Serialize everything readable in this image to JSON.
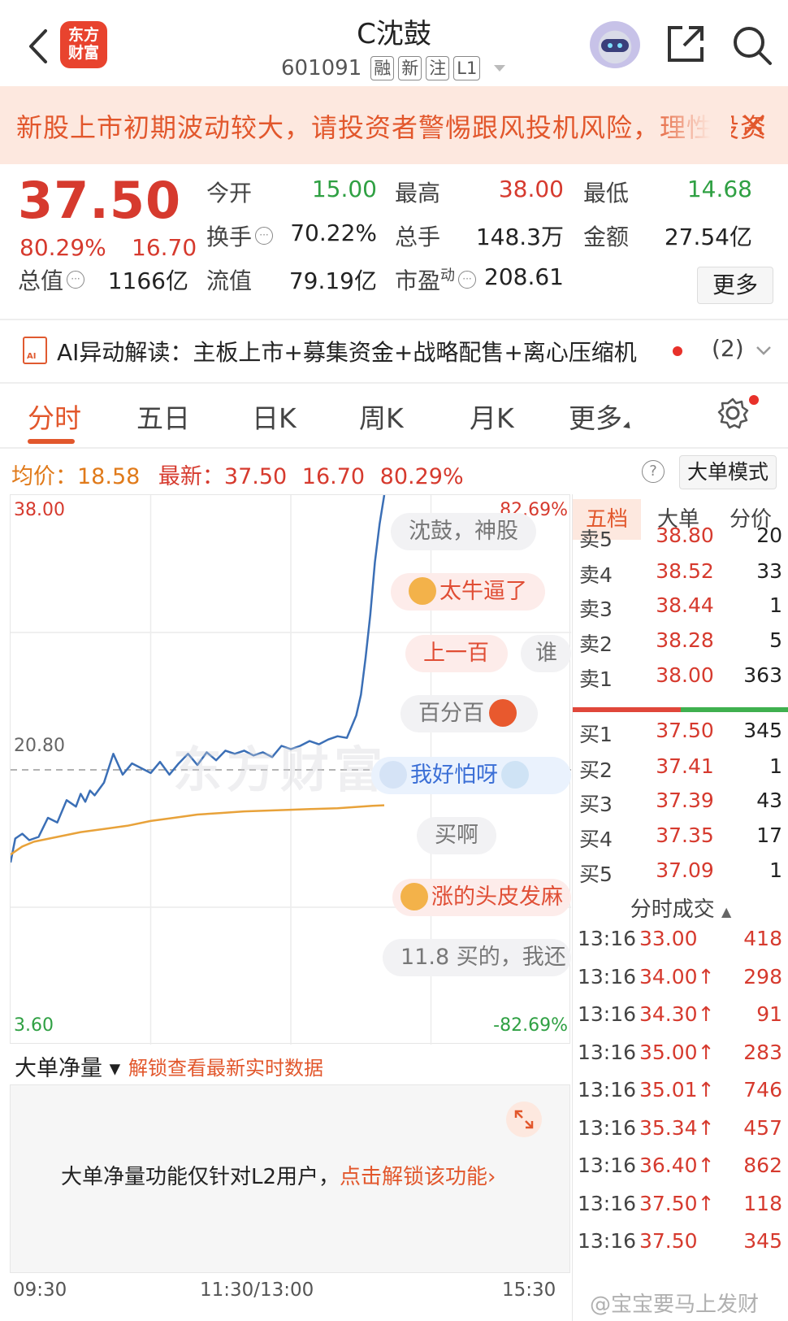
{
  "header": {
    "back_icon": "chevron-left-icon",
    "logo_line1": "东方",
    "logo_line2": "财富",
    "stock_name": "C沈鼓",
    "stock_code": "601091",
    "tags": [
      "融",
      "新",
      "注",
      "L1"
    ]
  },
  "banner": {
    "text": "新股上市初期波动较大，请投资者警惕跟风投机风险，理性投资"
  },
  "quote": {
    "price": "37.50",
    "change_pct": "80.29%",
    "change": "16.70",
    "fields": [
      {
        "label": "今开",
        "value": "15.00",
        "color": "#2fa043"
      },
      {
        "label": "最高",
        "value": "38.00",
        "color": "#d63a2e"
      },
      {
        "label": "最低",
        "value": "14.68",
        "color": "#2fa043"
      },
      {
        "label": "换手",
        "value": "70.22%",
        "color": "#222222"
      },
      {
        "label": "总手",
        "value": "148.3万",
        "color": "#222222"
      },
      {
        "label": "金额",
        "value": "27.54亿",
        "color": "#222222"
      },
      {
        "label": "总值",
        "value": "1166亿",
        "color": "#222222"
      },
      {
        "label": "流值",
        "value": "79.19亿",
        "color": "#222222"
      },
      {
        "label": "市盈",
        "value": "208.61",
        "color": "#222222"
      }
    ],
    "pe_sup": "动",
    "more_label": "更多"
  },
  "ai": {
    "text": "AI异动解读：主板上市+募集资金+战略配售+离心压缩机",
    "count": "(2)"
  },
  "tabs": [
    "分时",
    "五日",
    "日K",
    "周K",
    "月K",
    "更多"
  ],
  "avg_row": {
    "avg_label": "均价：",
    "avg_value": "18.58",
    "latest_label": "最新：",
    "latest_value": "37.50",
    "latest_change": "16.70",
    "latest_pct": "80.29%",
    "help": "?",
    "big_order_label": "大单模式"
  },
  "chart_axes": {
    "y_top": "38.00",
    "y_mid": "20.80",
    "y_bottom": "3.60",
    "pct_top": "82.69%",
    "pct_bottom": "-82.69%",
    "watermark": "东方财富"
  },
  "chart_data": {
    "type": "line",
    "xlabel": "",
    "ylabel": "",
    "x_ticks": [
      "09:30",
      "11:30/13:00",
      "15:30"
    ],
    "ylim": [
      3.6,
      38.0
    ],
    "reference": 20.8,
    "series": [
      {
        "color": "#3b6fb6",
        "x": [
          0,
          2,
          5,
          8,
          12,
          16,
          20,
          24,
          28,
          30,
          32,
          34,
          36,
          40,
          44,
          48,
          52,
          56,
          60,
          64,
          68,
          72,
          76,
          80,
          84,
          88,
          92,
          96,
          100,
          104,
          108,
          112,
          116,
          120,
          124,
          128,
          132,
          136,
          140,
          144,
          148,
          150,
          152,
          154,
          156,
          158,
          160
        ],
        "y": [
          15.0,
          16.5,
          16.8,
          16.4,
          16.6,
          17.8,
          17.5,
          18.9,
          18.5,
          19.3,
          18.8,
          19.5,
          19.2,
          20.0,
          21.8,
          20.5,
          21.2,
          20.9,
          20.6,
          21.3,
          20.5,
          21.2,
          21.8,
          21.1,
          21.9,
          21.4,
          22.0,
          21.8,
          22.0,
          21.7,
          21.9,
          21.6,
          22.3,
          22.1,
          22.3,
          22.6,
          22.4,
          22.7,
          22.9,
          22.8,
          24.2,
          25.5,
          27.8,
          30.5,
          33.8,
          36.2,
          38.0
        ]
      },
      {
        "color": "#e8a23a",
        "x": [
          0,
          5,
          10,
          20,
          30,
          40,
          50,
          60,
          70,
          80,
          90,
          100,
          110,
          120,
          130,
          140,
          150,
          155,
          160
        ],
        "y": [
          15.5,
          16.0,
          16.3,
          16.6,
          16.9,
          17.1,
          17.3,
          17.6,
          17.8,
          18.0,
          18.1,
          18.2,
          18.25,
          18.3,
          18.35,
          18.4,
          18.5,
          18.55,
          18.58
        ]
      }
    ]
  },
  "danmaku": [
    {
      "text": "沈鼓，神股",
      "style": "gray"
    },
    {
      "text": "太牛逼了",
      "style": "pink"
    },
    {
      "text": "上一百",
      "style": "pink"
    },
    {
      "text": "谁",
      "style": "gray"
    },
    {
      "text": "百分百",
      "style": "gray"
    },
    {
      "text": "我好怕呀",
      "style": "blue"
    },
    {
      "text": "买啊",
      "style": "gray"
    },
    {
      "text": "涨的头皮发麻",
      "style": "pink"
    },
    {
      "text": "11.8 买的，我还",
      "style": "gray"
    }
  ],
  "orderbook": {
    "tabs": [
      "五档",
      "大单",
      "分价"
    ],
    "sells": [
      {
        "label": "卖5",
        "price": "38.80",
        "vol": "20"
      },
      {
        "label": "卖4",
        "price": "38.52",
        "vol": "33"
      },
      {
        "label": "卖3",
        "price": "38.44",
        "vol": "1"
      },
      {
        "label": "卖2",
        "price": "38.28",
        "vol": "5"
      },
      {
        "label": "卖1",
        "price": "38.00",
        "vol": "363"
      }
    ],
    "buys": [
      {
        "label": "买1",
        "price": "37.50",
        "vol": "345"
      },
      {
        "label": "买2",
        "price": "37.41",
        "vol": "1"
      },
      {
        "label": "买3",
        "price": "37.39",
        "vol": "43"
      },
      {
        "label": "买4",
        "price": "37.35",
        "vol": "17"
      },
      {
        "label": "买5",
        "price": "37.09",
        "vol": "1"
      }
    ],
    "trades_title": "分时成交",
    "trades": [
      {
        "time": "13:16",
        "price": "33.00",
        "vol": "418"
      },
      {
        "time": "13:16",
        "price": "34.00↑",
        "vol": "298"
      },
      {
        "time": "13:16",
        "price": "34.30↑",
        "vol": "91"
      },
      {
        "time": "13:16",
        "price": "35.00↑",
        "vol": "283"
      },
      {
        "time": "13:16",
        "price": "35.01↑",
        "vol": "746"
      },
      {
        "time": "13:16",
        "price": "35.34↑",
        "vol": "457"
      },
      {
        "time": "13:16",
        "price": "36.40↑",
        "vol": "862"
      },
      {
        "time": "13:16",
        "price": "37.50↑",
        "vol": "118"
      },
      {
        "time": "13:16",
        "price": "37.50",
        "vol": "345"
      }
    ]
  },
  "indicator": {
    "select_label": "大单净量 ▾",
    "lock_text": "解锁查看最新实时数据",
    "panel_text_prefix": "大单净量功能仅针对L2用户，",
    "panel_link": "点击解锁该功能›"
  },
  "time_axis": {
    "start": "09:30",
    "mid": "11:30/13:00",
    "end": "15:30"
  },
  "watermark_credit": "@宝宝要马上发财"
}
